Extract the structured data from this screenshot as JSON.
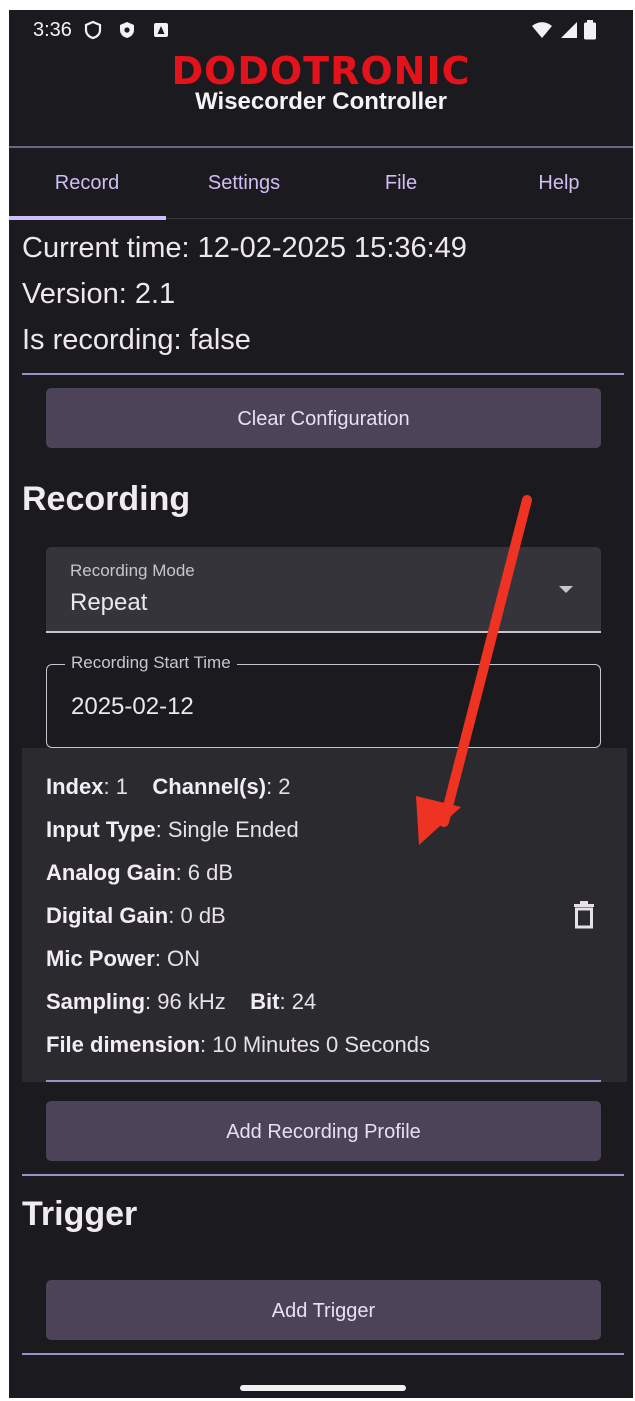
{
  "status_bar": {
    "time": "3:36",
    "left_icons": [
      "shield-outline-icon",
      "shield-filled-icon",
      "app-notification-icon"
    ],
    "right_icons": [
      "wifi-icon",
      "cell-signal-icon",
      "battery-icon"
    ]
  },
  "header": {
    "logo": "DODOTRONIC",
    "subtitle": "Wisecorder Controller",
    "logo_color": "#e3121b"
  },
  "tabs": [
    {
      "label": "Record",
      "active": true
    },
    {
      "label": "Settings",
      "active": false
    },
    {
      "label": "File",
      "active": false
    },
    {
      "label": "Help",
      "active": false
    }
  ],
  "info": {
    "current_time": "Current time: 12-02-2025 15:36:49",
    "version": "Version: 2.1",
    "is_recording": "Is recording: false"
  },
  "buttons": {
    "clear_configuration": "Clear Configuration",
    "add_recording_profile": "Add Recording Profile",
    "add_trigger": "Add Trigger"
  },
  "recording": {
    "title": "Recording",
    "mode_label": "Recording Mode",
    "mode_value": "Repeat",
    "start_time_label": "Recording Start Time",
    "start_time_value": "2025-02-12"
  },
  "profile": {
    "index_label": "Index",
    "index_value": ": 1",
    "channels_label": "Channel(s)",
    "channels_value": ": 2",
    "input_type_label": "Input Type",
    "input_type_value": ": Single Ended",
    "analog_gain_label": "Analog Gain",
    "analog_gain_value": ": 6 dB",
    "digital_gain_label": "Digital Gain",
    "digital_gain_value": ": 0 dB",
    "mic_power_label": "Mic Power",
    "mic_power_value": ": ON",
    "sampling_label": "Sampling",
    "sampling_value": ": 96 kHz",
    "bit_label": "Bit",
    "bit_value": ": 24",
    "file_dimension_label": "File dimension",
    "file_dimension_value": ": 10 Minutes 0 Seconds"
  },
  "trigger": {
    "title": "Trigger"
  },
  "colors": {
    "background": "#1b1a1f",
    "accent": "#cfbcff",
    "button": "#4c4358",
    "annotation_arrow": "#ee3322"
  }
}
